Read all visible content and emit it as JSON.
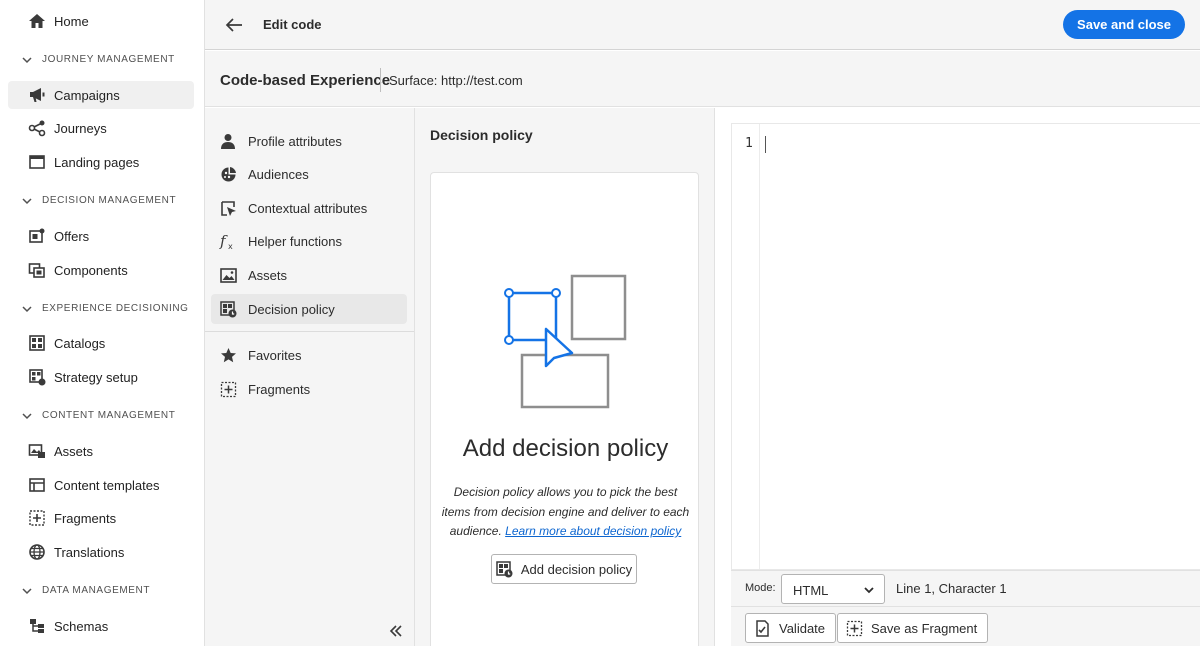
{
  "nav": {
    "home": "Home",
    "sections": {
      "journey": "JOURNEY MANAGEMENT",
      "decision": "DECISION MANAGEMENT",
      "experience": "EXPERIENCE DECISIONING",
      "content": "CONTENT MANAGEMENT",
      "data": "DATA MANAGEMENT"
    },
    "items": {
      "campaigns": "Campaigns",
      "journeys": "Journeys",
      "landing_pages": "Landing pages",
      "offers": "Offers",
      "components": "Components",
      "catalogs": "Catalogs",
      "strategy_setup": "Strategy setup",
      "assets": "Assets",
      "content_templates": "Content templates",
      "fragments": "Fragments",
      "translations": "Translations",
      "schemas": "Schemas"
    },
    "active": "Campaigns"
  },
  "topbar": {
    "title": "Edit code",
    "save_label": "Save and close"
  },
  "header": {
    "title": "Code-based Experience",
    "surface": "Surface: http://test.com"
  },
  "attributes": {
    "profile": "Profile attributes",
    "audiences": "Audiences",
    "contextual": "Contextual attributes",
    "helpers": "Helper functions",
    "assets": "Assets",
    "decision_policy": "Decision policy",
    "favorites": "Favorites",
    "fragments": "Fragments",
    "active": "Decision policy"
  },
  "decision": {
    "panel_title": "Decision policy",
    "card_title": "Add decision policy",
    "desc": "Decision policy allows you to pick the best items from decision engine and deliver to each audience.",
    "learn_more": "Learn more about decision policy",
    "button": "Add decision policy"
  },
  "editor": {
    "line_number": "1",
    "mode_label": "Mode:",
    "mode_value": "HTML",
    "position": "Line 1, Character 1",
    "validate": "Validate",
    "save_fragment": "Save as Fragment"
  },
  "colors": {
    "accent": "#1473e6",
    "illustration_blue": "#1473e6",
    "illustration_gray": "#8e8e8e"
  }
}
